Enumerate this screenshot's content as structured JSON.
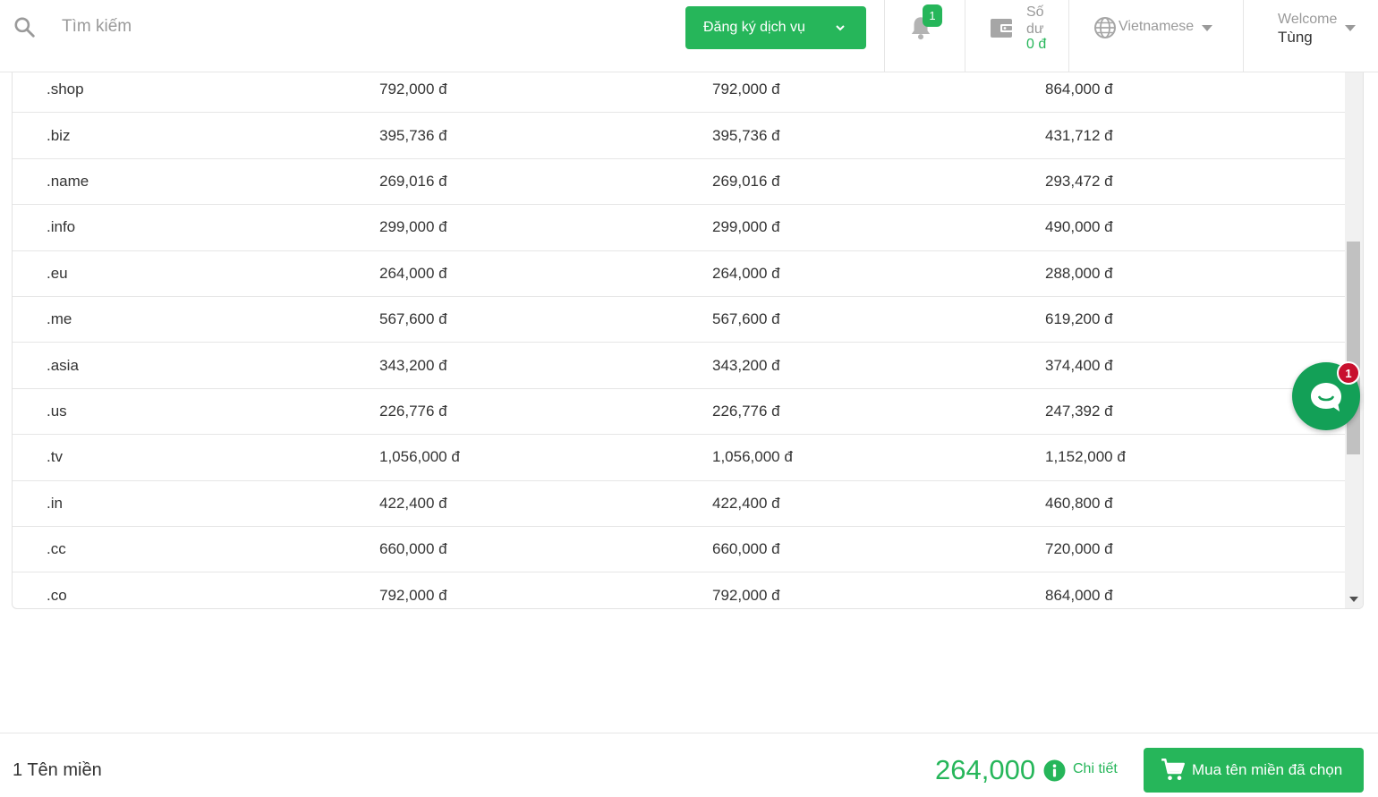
{
  "header": {
    "search_placeholder": "Tìm kiếm",
    "register_button": "Đăng ký dịch vụ",
    "notification_count": "1",
    "balance_label": "Số dư",
    "balance_value": "0 đ",
    "language": "Vietnamese",
    "welcome_label": "Welcome",
    "user_name": "Tùng"
  },
  "pricing_table": {
    "rows": [
      {
        "tld": ".shop",
        "col1": "792,000 đ",
        "col2": "792,000 đ",
        "col3": "864,000 đ"
      },
      {
        "tld": ".biz",
        "col1": "395,736 đ",
        "col2": "395,736 đ",
        "col3": "431,712 đ"
      },
      {
        "tld": ".name",
        "col1": "269,016 đ",
        "col2": "269,016 đ",
        "col3": "293,472 đ"
      },
      {
        "tld": ".info",
        "col1": "299,000 đ",
        "col2": "299,000 đ",
        "col3": "490,000 đ"
      },
      {
        "tld": ".eu",
        "col1": "264,000 đ",
        "col2": "264,000 đ",
        "col3": "288,000 đ"
      },
      {
        "tld": ".me",
        "col1": "567,600 đ",
        "col2": "567,600 đ",
        "col3": "619,200 đ"
      },
      {
        "tld": ".asia",
        "col1": "343,200 đ",
        "col2": "343,200 đ",
        "col3": "374,400 đ"
      },
      {
        "tld": ".us",
        "col1": "226,776 đ",
        "col2": "226,776 đ",
        "col3": "247,392 đ"
      },
      {
        "tld": ".tv",
        "col1": "1,056,000 đ",
        "col2": "1,056,000 đ",
        "col3": "1,152,000 đ"
      },
      {
        "tld": ".in",
        "col1": "422,400 đ",
        "col2": "422,400 đ",
        "col3": "460,800 đ"
      },
      {
        "tld": ".cc",
        "col1": "660,000 đ",
        "col2": "660,000 đ",
        "col3": "720,000 đ"
      },
      {
        "tld": ".co",
        "col1": "792,000 đ",
        "col2": "792,000 đ",
        "col3": "864,000 đ"
      }
    ]
  },
  "chat": {
    "badge_count": "1"
  },
  "footer": {
    "domain_count": "1 Tên miền",
    "total_price": "264,000",
    "detail_link": "Chi tiết",
    "buy_button": "Mua tên miền đã chọn"
  },
  "colors": {
    "accent": "#26b65a",
    "chat": "#13a057",
    "badge_red": "#c8102e"
  },
  "icons": [
    "search-icon",
    "chevron-down-icon",
    "bell-icon",
    "wallet-icon",
    "globe-icon",
    "caret-down-icon",
    "chat-icon",
    "info-icon",
    "cart-icon"
  ]
}
